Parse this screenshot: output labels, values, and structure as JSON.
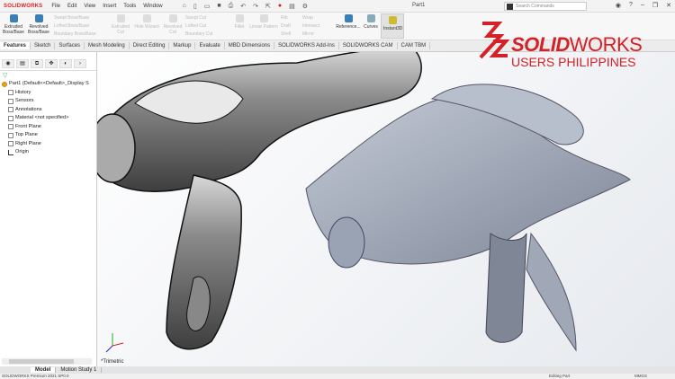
{
  "titlebar": {
    "logo": "SOLIDWORKS",
    "menu": [
      "File",
      "Edit",
      "View",
      "Insert",
      "Tools",
      "Window"
    ],
    "doc_title": "Part1",
    "search_placeholder": "Search Commands"
  },
  "ribbon": {
    "items": [
      "Extruded Boss/Base",
      "Revolved Boss/Base",
      "Swept Boss/Base",
      "Lofted Boss/Base",
      "Boundary Boss/Base",
      "Extruded Cut",
      "Hole Wizard",
      "Revolved Cut",
      "Swept Cut",
      "Lofted Cut",
      "Boundary Cut",
      "Fillet",
      "Linear Pattern",
      "Rib",
      "Draft",
      "Shell",
      "Wrap",
      "Intersect",
      "Mirror",
      "Reference...",
      "Curves",
      "Instant3D"
    ]
  },
  "tabs": [
    "Features",
    "Sketch",
    "Surfaces",
    "Mesh Modeling",
    "Direct Editing",
    "Markup",
    "Evaluate",
    "MBD Dimensions",
    "SOLIDWORKS Add-Ins",
    "SOLIDWORKS CAM",
    "CAM TBM"
  ],
  "tree": {
    "root": "Part1  (Default<<Default>_Display S",
    "items": [
      "History",
      "Sensors",
      "Annotations",
      "Material <not specified>",
      "Front Plane",
      "Top Plane",
      "Right Plane",
      "Origin"
    ]
  },
  "viewport": {
    "view_label": "*Trimetric"
  },
  "bottom_tabs": [
    "Model",
    "Motion Study 1"
  ],
  "status": {
    "left": "SOLIDWORKS Premium 2021 SP0.0",
    "mode": "Editing Part",
    "units": "MMGS"
  },
  "brand": {
    "name_bold": "SOLID",
    "name_light": "WORKS",
    "subtitle": "USERS PHILIPPINES",
    "color": "#d42027"
  }
}
